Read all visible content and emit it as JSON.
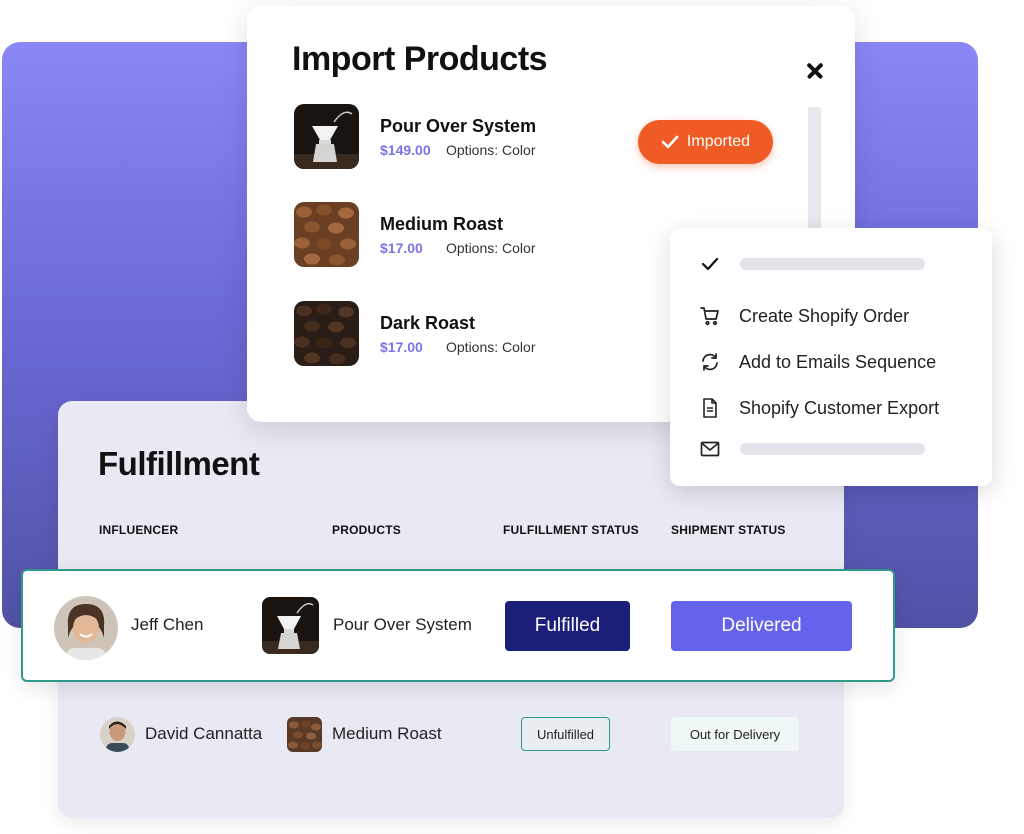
{
  "import_products": {
    "title": "Import Products",
    "close_icon": "close-icon",
    "imported_label": "Imported",
    "products": [
      {
        "name": "Pour Over System",
        "price": "$149.00",
        "options": "Options: Color"
      },
      {
        "name": "Medium Roast",
        "price": "$17.00",
        "options": "Options: Color"
      },
      {
        "name": "Dark Roast",
        "price": "$17.00",
        "options": "Options: Color"
      }
    ]
  },
  "action_menu": {
    "items": [
      {
        "icon": "check-icon",
        "label": ""
      },
      {
        "icon": "cart-icon",
        "label": "Create Shopify Order"
      },
      {
        "icon": "refresh-icon",
        "label": "Add to Emails Sequence"
      },
      {
        "icon": "document-icon",
        "label": "Shopify Customer Export"
      },
      {
        "icon": "mail-icon",
        "label": ""
      }
    ]
  },
  "fulfillment": {
    "title": "Fulfillment",
    "columns": [
      "INFLUENCER",
      "PRODUCTS",
      "FULFILLMENT STATUS",
      "SHIPMENT STATUS"
    ],
    "rows": [
      {
        "influencer": "Jeff Chen",
        "product": "Pour Over System",
        "fulfillment_status": "Fulfilled",
        "shipment_status": "Delivered"
      },
      {
        "influencer": "David Cannatta",
        "product": "Medium Roast",
        "fulfillment_status": "Unfulfilled",
        "shipment_status": "Out for Delivery"
      }
    ]
  },
  "colors": {
    "accent": "#6563ec",
    "imported": "#f05a24",
    "fulfilled": "#1c1f7a",
    "price": "#7a74e6",
    "row_border": "#2f9a8a"
  }
}
